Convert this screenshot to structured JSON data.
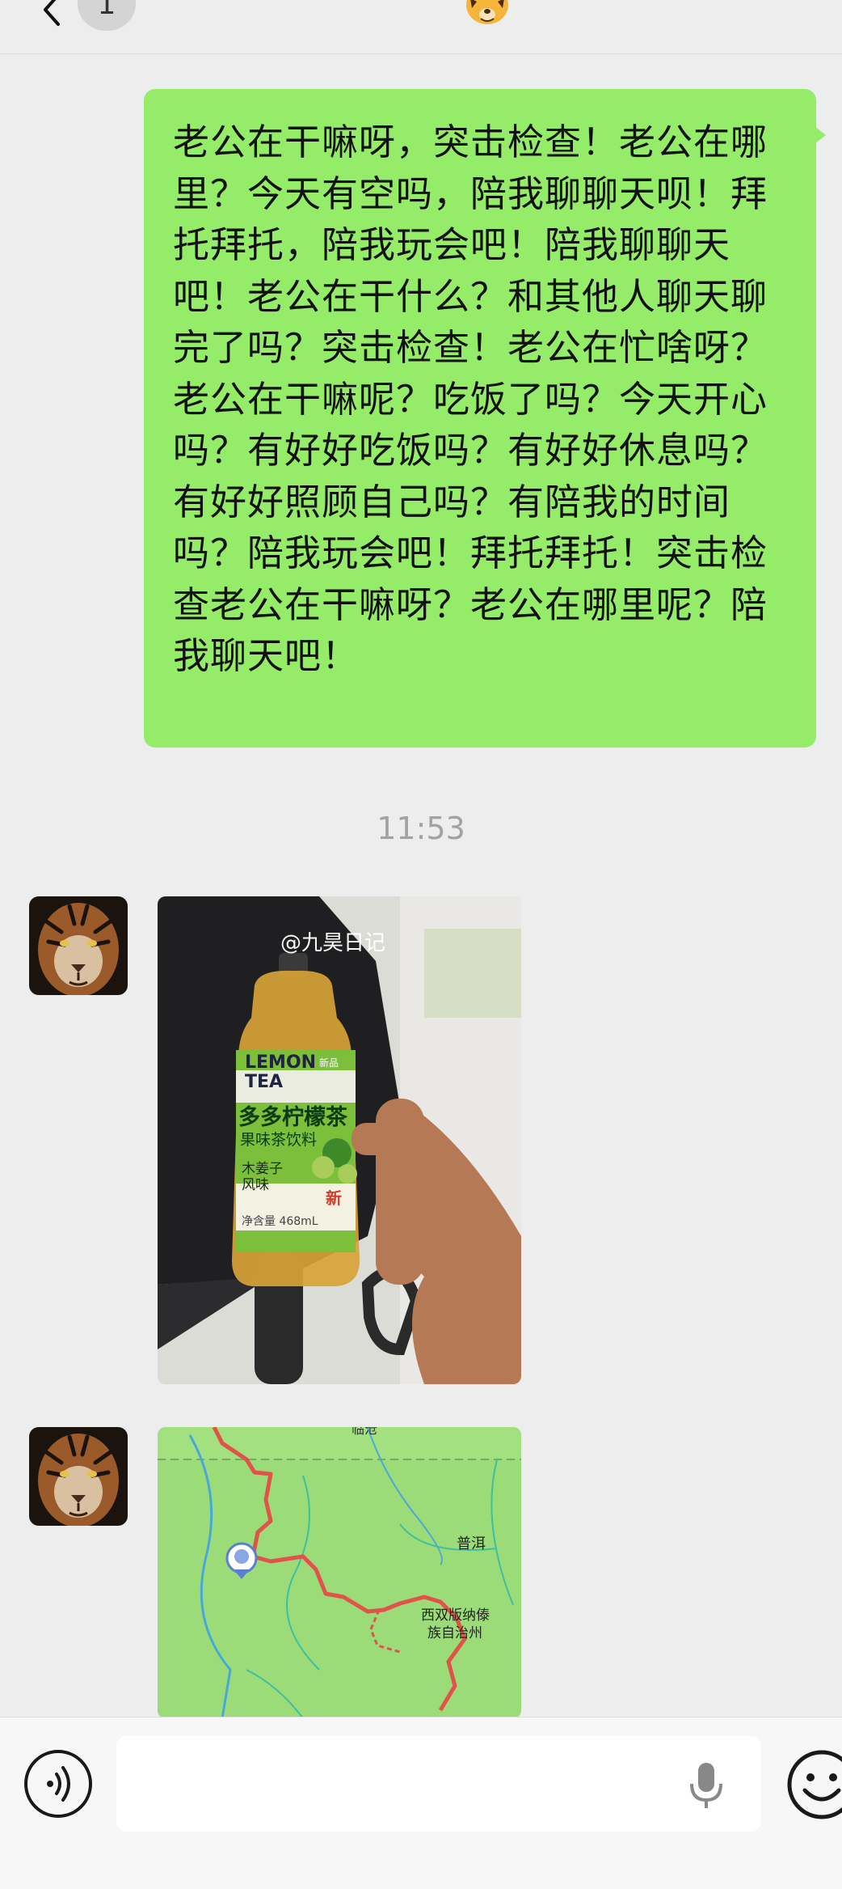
{
  "header": {
    "unread_count": "1",
    "contact_emoji": "tiger-face-emoji"
  },
  "messages": {
    "sent_text": "老公在干嘛呀，突击检查！老公在哪里？今天有空吗，陪我聊聊天呗！拜托拜托，陪我玩会吧！陪我聊聊天吧！老公在干什么？和其他人聊天聊完了吗？突击检查！老公在忙啥呀？老公在干嘛呢？吃饭了吗？今天开心吗？有好好吃饭吗？有好好休息吗？有好好照顾自己吗？有陪我的时间吗？陪我玩会吧！拜托拜托！突击检查老公在干嘛呀？老公在哪里呢？陪我聊天吧！",
    "timestamp": "11:53"
  },
  "photo": {
    "watermark": "@九昊日记",
    "bottle_brand_line1": "LEMON",
    "bottle_brand_line2": "TEA",
    "bottle_tag": "新品",
    "bottle_name": "多多柠檬茶",
    "bottle_subtitle": "果味茶饮料",
    "bottle_flavor_line1": "木姜子",
    "bottle_flavor_line2": "风味",
    "bottle_new": "新",
    "bottle_volume": "净含量 468mL"
  },
  "map": {
    "city_label": "普洱",
    "region_label_line1": "西双版纳傣",
    "region_label_line2": "族自治州",
    "top_label": "临沧"
  },
  "input_bar": {
    "placeholder": ""
  },
  "colors": {
    "sent_bubble": "#95ec69",
    "background": "#ededed",
    "map_land": "#9bdc79",
    "route": "#e0524a"
  }
}
